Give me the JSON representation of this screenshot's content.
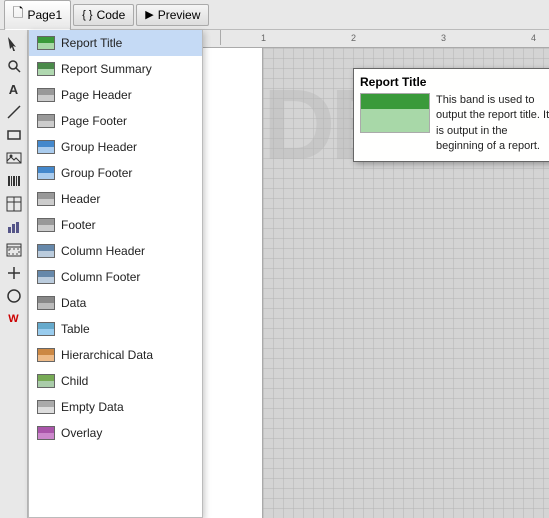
{
  "tabs": [
    {
      "label": "Page1",
      "icon": "page",
      "active": true
    },
    {
      "label": "Code",
      "icon": "code",
      "active": false
    },
    {
      "label": "Preview",
      "icon": "preview",
      "active": false
    }
  ],
  "menu": {
    "items": [
      {
        "label": "Report Title",
        "selected": true,
        "color1": "#3a9a3a",
        "color2": "#a8d8a8"
      },
      {
        "label": "Report Summary",
        "selected": false,
        "color1": "#4a8a4a",
        "color2": "#b0d8b0"
      },
      {
        "label": "Page Header",
        "selected": false,
        "color1": "#999",
        "color2": "#ccc"
      },
      {
        "label": "Page Footer",
        "selected": false,
        "color1": "#999",
        "color2": "#ccc"
      },
      {
        "label": "Group Header",
        "selected": false,
        "color1": "#4488cc",
        "color2": "#aaccee"
      },
      {
        "label": "Group Footer",
        "selected": false,
        "color1": "#4488cc",
        "color2": "#aaccee"
      },
      {
        "label": "Header",
        "selected": false,
        "color1": "#999",
        "color2": "#ccc"
      },
      {
        "label": "Footer",
        "selected": false,
        "color1": "#999",
        "color2": "#ccc"
      },
      {
        "label": "Column Header",
        "selected": false,
        "color1": "#6688aa",
        "color2": "#bbccdd"
      },
      {
        "label": "Column Footer",
        "selected": false,
        "color1": "#6688aa",
        "color2": "#bbccdd"
      },
      {
        "label": "Data",
        "selected": false,
        "color1": "#888",
        "color2": "#bbb"
      },
      {
        "label": "Table",
        "selected": false,
        "color1": "#66aacc",
        "color2": "#99ccee"
      },
      {
        "label": "Hierarchical Data",
        "selected": false,
        "color1": "#cc8844",
        "color2": "#eebb88"
      },
      {
        "label": "Child",
        "selected": false,
        "color1": "#77aa55",
        "color2": "#aaccaa"
      },
      {
        "label": "Empty Data",
        "selected": false,
        "color1": "#aaa",
        "color2": "#ddd"
      },
      {
        "label": "Overlay",
        "selected": false,
        "color1": "#aa55aa",
        "color2": "#cc88cc"
      }
    ]
  },
  "tooltip": {
    "title": "Report Title",
    "description": "This band is used to output the report title. It is output in the beginning of a report."
  },
  "canvas": {
    "watermark": "DEM",
    "ruler_marks": [
      "1",
      "2",
      "3",
      "4"
    ]
  }
}
